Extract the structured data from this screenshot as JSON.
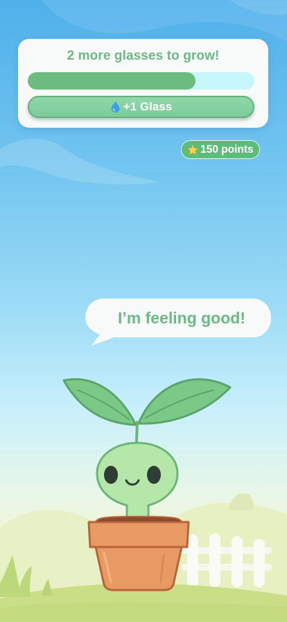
{
  "status": {
    "title": "2 more glasses to grow!",
    "progress": 0.74,
    "button_label": "+1 Glass",
    "button_icon": "water-drop-icon"
  },
  "points": {
    "label": "150 points",
    "icon": "star-icon"
  },
  "speech": {
    "text": "I’m feeling good!"
  },
  "colors": {
    "accent_green": "#6cbc80",
    "title_green": "#6db886",
    "track": "#c6f8fb",
    "pot": "#e99a63",
    "sky_top": "#4fb0ea"
  }
}
